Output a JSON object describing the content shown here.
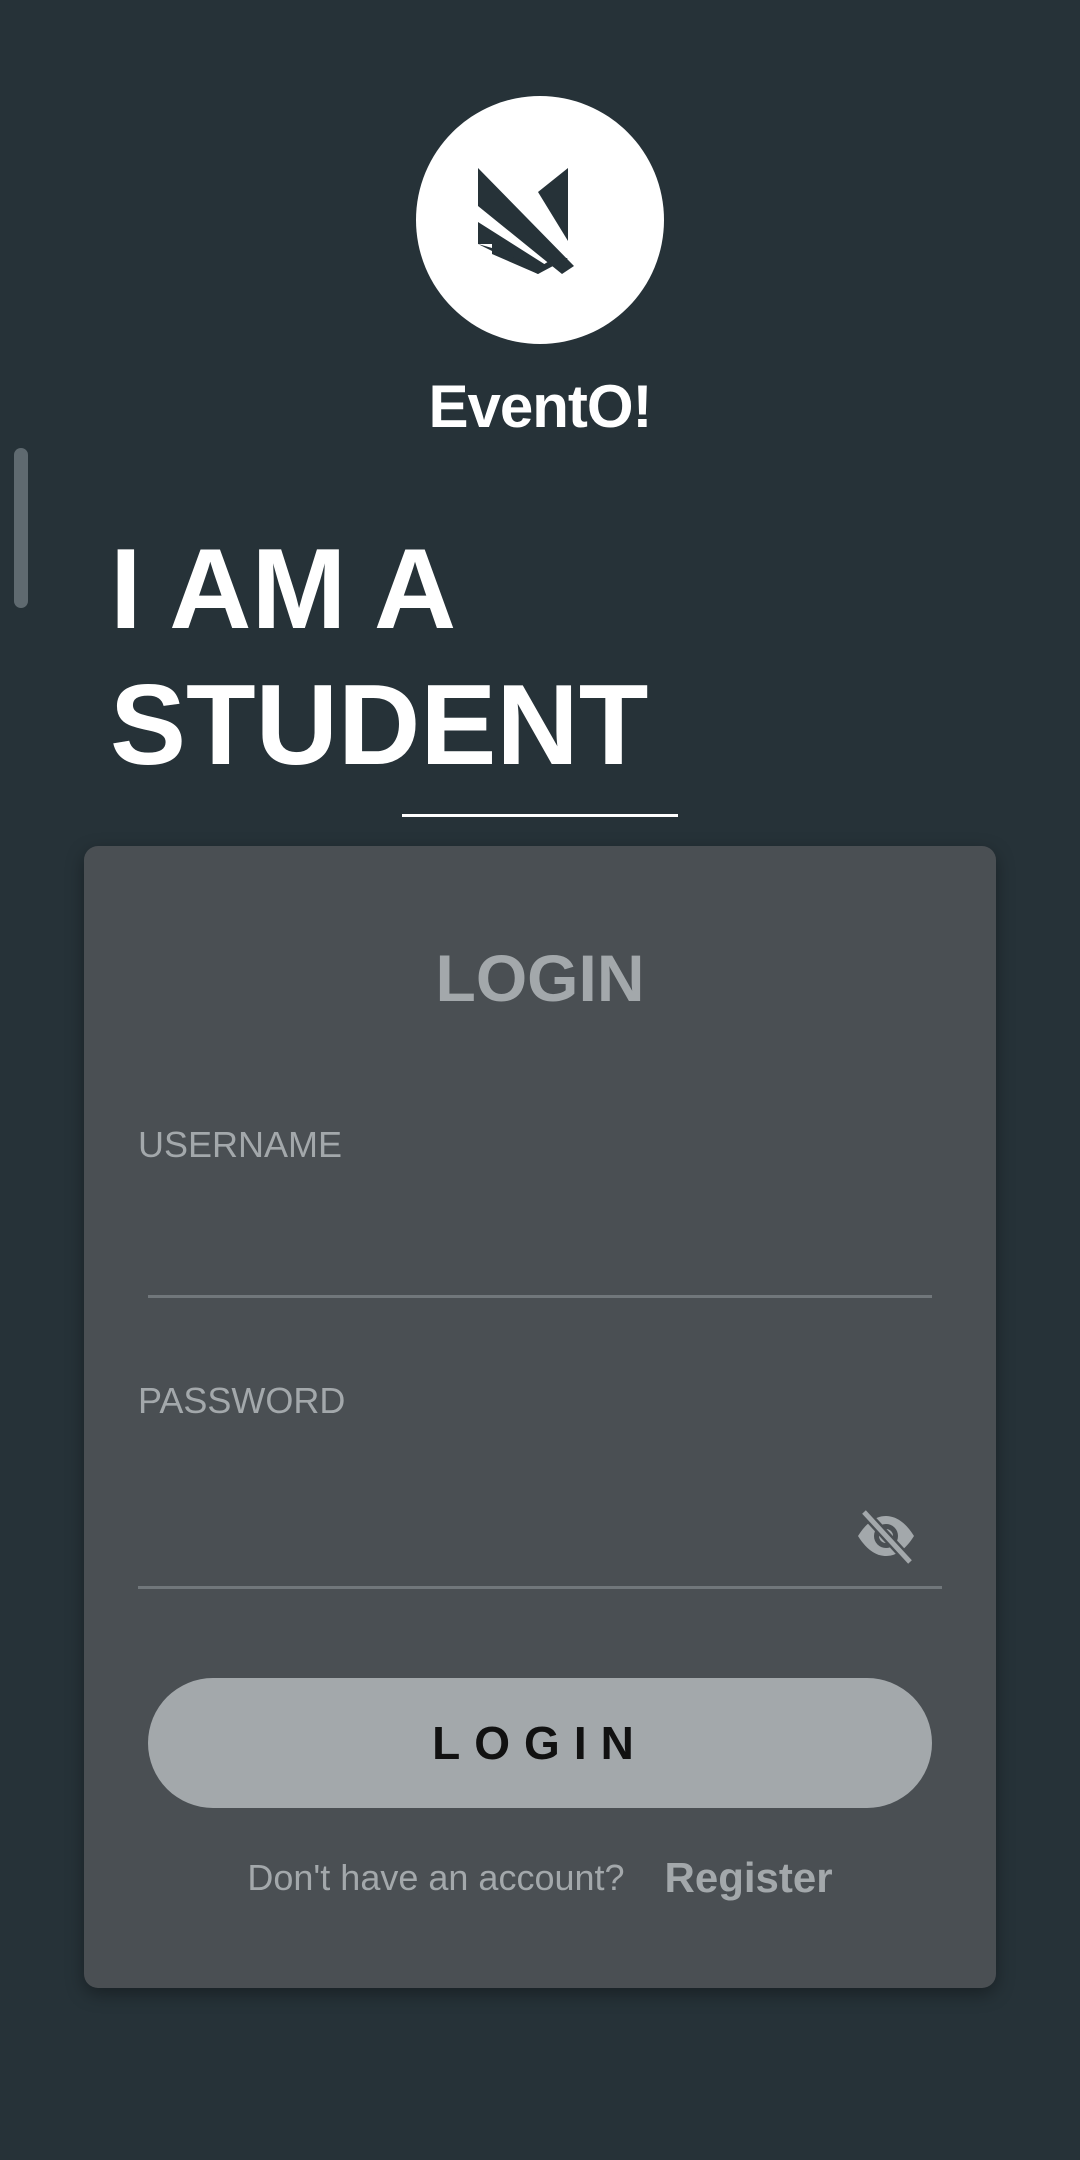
{
  "app": {
    "name": "EventO!",
    "logo_icon": "evento-logo-icon"
  },
  "hero": {
    "line1": "I AM A",
    "line2": "STUDENT"
  },
  "login_card": {
    "title": "LOGIN",
    "username": {
      "label": "USERNAME",
      "value": "",
      "placeholder": ""
    },
    "password": {
      "label": "PASSWORD",
      "value": "",
      "placeholder": "",
      "toggle_icon": "eye-off-icon"
    },
    "submit_label": "LOGIN",
    "register_prompt": "Don't have an account?",
    "register_label": "Register"
  },
  "colors": {
    "background": "#263238",
    "card": "#4a4f53",
    "muted_text": "#a3a8ab",
    "button": "#a3a8ab",
    "white": "#ffffff"
  }
}
